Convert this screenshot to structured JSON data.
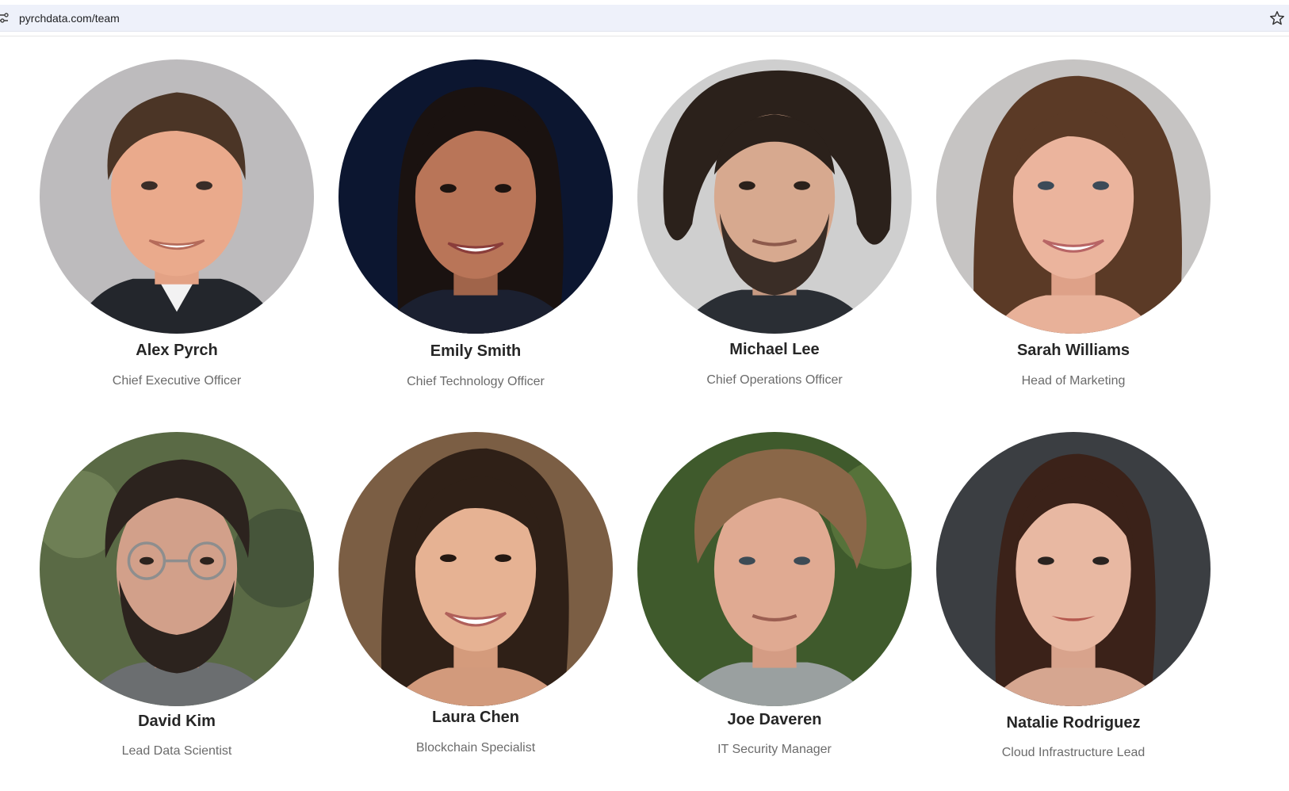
{
  "browser": {
    "url": "pyrchdata.com/team",
    "icons": [
      "tune-icon",
      "bookmark-star-icon"
    ]
  },
  "team": {
    "members": [
      {
        "name": "Alex Pyrch",
        "role": "Chief Executive Officer"
      },
      {
        "name": "Emily Smith",
        "role": "Chief Technology Officer"
      },
      {
        "name": "Michael Lee",
        "role": "Chief Operations Officer"
      },
      {
        "name": "Sarah Williams",
        "role": "Head of Marketing"
      },
      {
        "name": "David Kim",
        "role": "Lead Data Scientist"
      },
      {
        "name": "Laura Chen",
        "role": "Blockchain Specialist"
      },
      {
        "name": "Joe Daveren",
        "role": "IT Security Manager"
      },
      {
        "name": "Natalie Rodriguez",
        "role": "Cloud Infrastructure Lead"
      }
    ]
  }
}
